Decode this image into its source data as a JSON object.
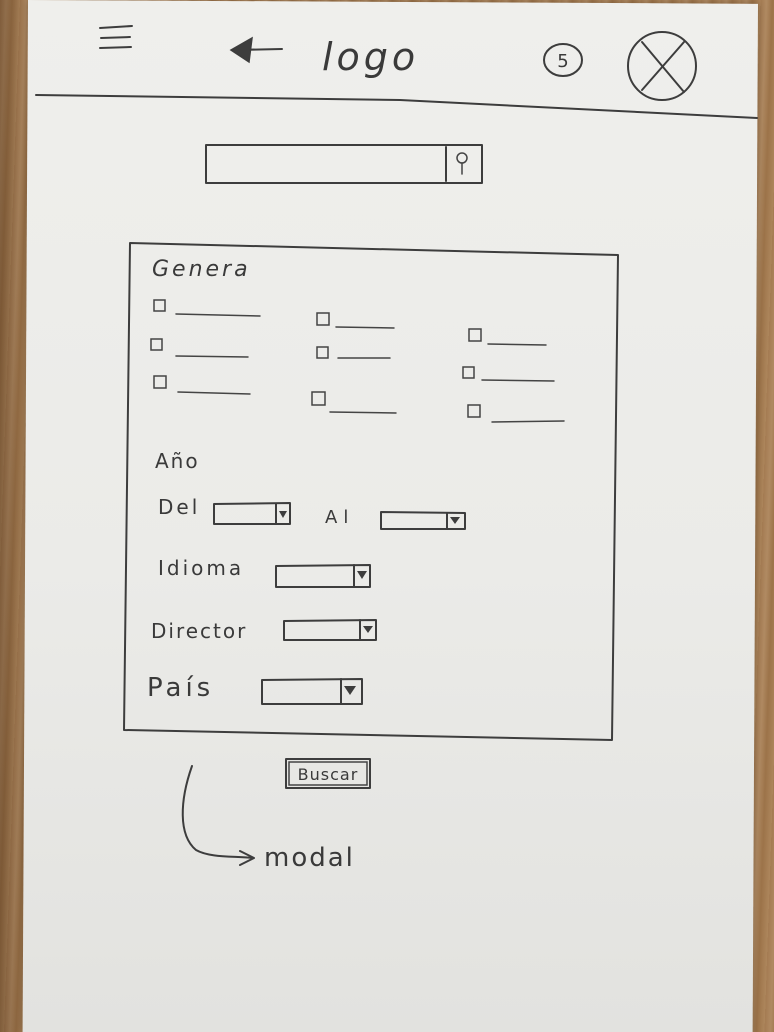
{
  "header": {
    "logo_text": "logo",
    "notification_count": "5"
  },
  "search": {
    "value": ""
  },
  "filter_modal": {
    "genre_heading": "Genera",
    "genre_checkbox_count": 9,
    "year_heading": "Año",
    "year_from_label": "Del",
    "year_to_label": "Al",
    "language_label": "Idioma",
    "director_label": "Director",
    "country_label": "País"
  },
  "search_button_label": "Buscar",
  "annotation_text": "modal",
  "colors": {
    "paper": "#ececea",
    "ink": "#3d3d3d",
    "desk": "#a8835a"
  }
}
